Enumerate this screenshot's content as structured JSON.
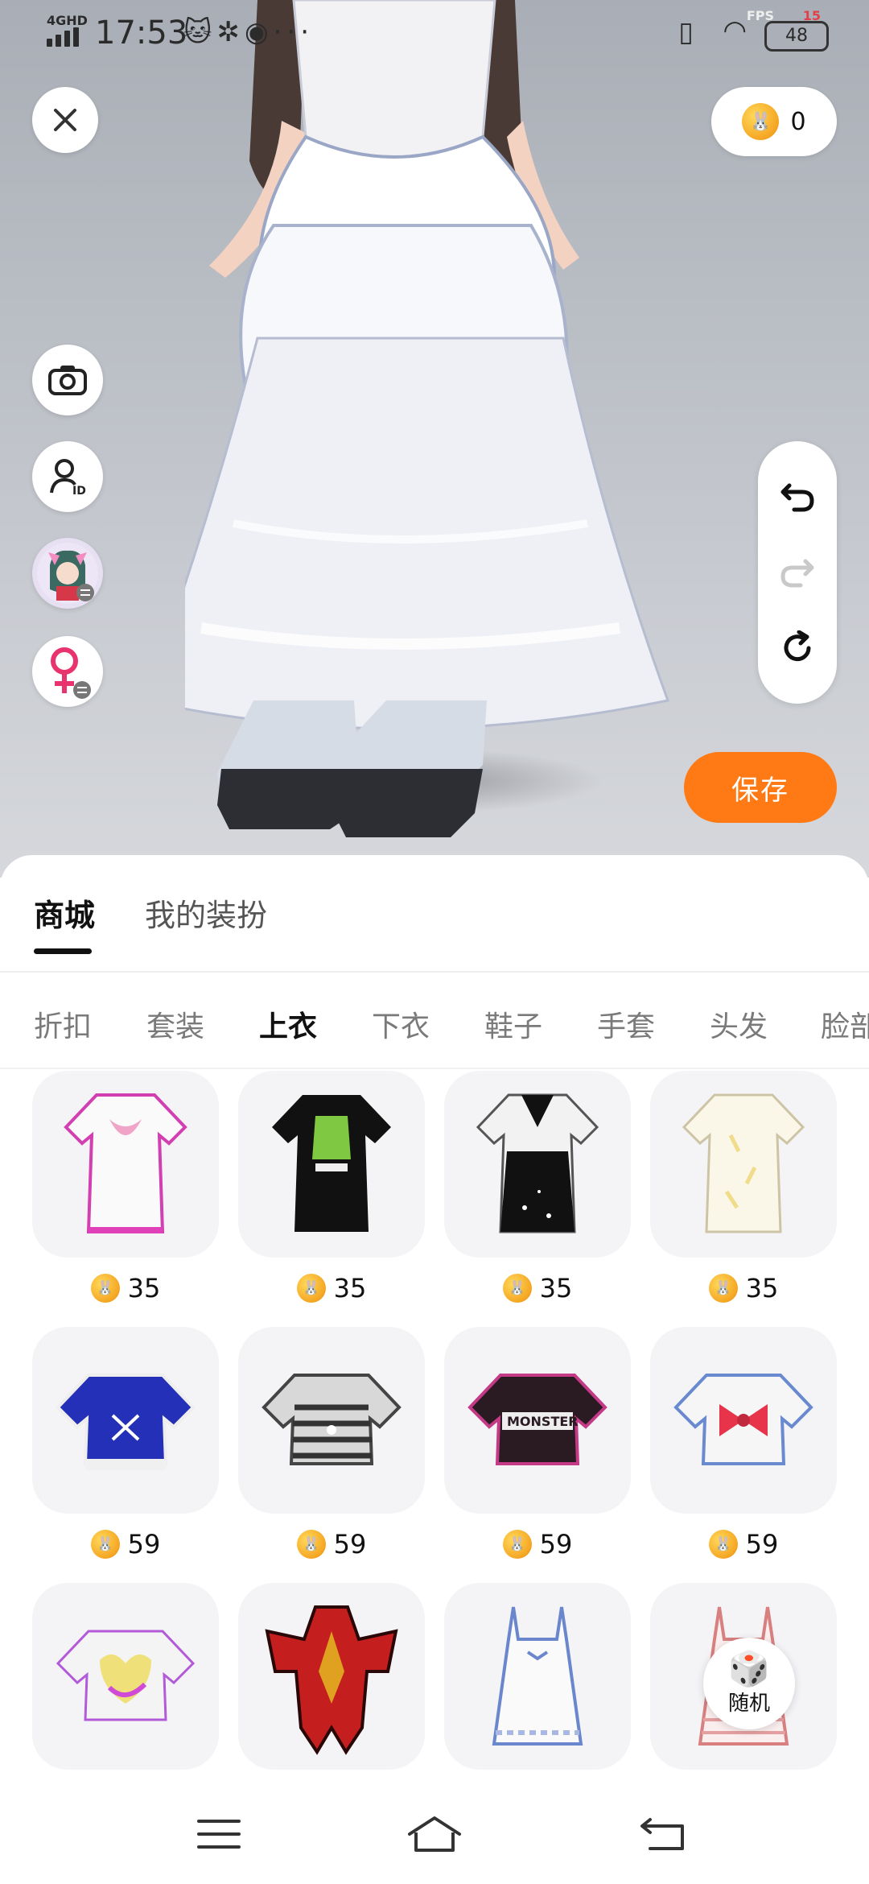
{
  "status_bar": {
    "network": "4GHD",
    "time": "17:53",
    "notification_icons": [
      "cat-icon",
      "fan-icon",
      "voice-icon",
      "more-icon"
    ],
    "more": "···",
    "fps_label": "FPS",
    "fps_value": "15",
    "battery": "48"
  },
  "top": {
    "coin_balance": "0"
  },
  "left_tools": [
    "camera-icon",
    "avatar-id-icon",
    "character-switch-icon",
    "gender-switch-icon"
  ],
  "history_controls": [
    "undo-icon",
    "redo-icon",
    "reset-icon"
  ],
  "save_label": "保存",
  "sheet": {
    "main_tabs": [
      {
        "label": "商城",
        "active": true
      },
      {
        "label": "我的装扮",
        "active": false
      }
    ],
    "category_tabs": [
      {
        "label": "折扣",
        "active": false
      },
      {
        "label": "套装",
        "active": false
      },
      {
        "label": "上衣",
        "active": true
      },
      {
        "label": "下衣",
        "active": false
      },
      {
        "label": "鞋子",
        "active": false
      },
      {
        "label": "手套",
        "active": false
      },
      {
        "label": "头发",
        "active": false
      },
      {
        "label": "脸部",
        "active": false
      }
    ],
    "items": [
      {
        "price": "35",
        "desc": "pink-heart-dress"
      },
      {
        "price": "35",
        "desc": "black-graphic-dress"
      },
      {
        "price": "35",
        "desc": "black-white-dress"
      },
      {
        "price": "35",
        "desc": "cream-floral-dress"
      },
      {
        "price": "59",
        "desc": "blue-crop-top"
      },
      {
        "price": "59",
        "desc": "striped-crop-top"
      },
      {
        "price": "59",
        "desc": "monster-crop-top"
      },
      {
        "price": "59",
        "desc": "bow-crop-top"
      },
      {
        "price": "",
        "desc": "heart-graphic-crop-top"
      },
      {
        "price": "",
        "desc": "red-armor-outfit"
      },
      {
        "price": "",
        "desc": "white-slip-dress"
      },
      {
        "price": "",
        "desc": "pink-lace-dress"
      }
    ]
  },
  "random_label": "随机",
  "colors": {
    "accent": "#ff7a14",
    "coin": "#f5a623",
    "card_bg": "#f4f4f7"
  }
}
